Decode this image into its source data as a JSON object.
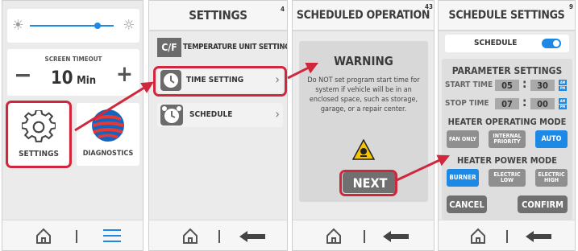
{
  "panel1": {
    "slider_value": 0.8,
    "screen_timeout": {
      "label": "SCREEN TIMEOUT",
      "minus": "−",
      "plus": "+",
      "value": "10",
      "unit": "Min"
    },
    "settings_label": "SETTINGS",
    "diagnostics_label": "DIAGNOSTICS"
  },
  "panel2": {
    "title": "SETTINGS",
    "page_number": "4",
    "items": [
      {
        "label": "TEMPERATURE UNIT SETTINGS",
        "icon": "temperature-unit-icon",
        "chevron": "›"
      },
      {
        "label": "TIME SETTING",
        "icon": "clock-icon",
        "chevron": "›"
      },
      {
        "label": "SCHEDULE",
        "icon": "alarm-clock-icon",
        "chevron": "›"
      }
    ]
  },
  "panel3": {
    "title": "SCHEDULED OPERATION",
    "page_number": "43",
    "warning_title": "WARNING",
    "warning_text": "Do NOT set program start time for system if vehicle will be in an enclosed space, such as storage, garage, or a repair center.",
    "next_label": "NEXT"
  },
  "panel4": {
    "title": "SCHEDULE SETTINGS",
    "page_number": "9",
    "schedule_label": "SCHEDULE",
    "schedule_on": true,
    "parameter_title": "PARAMETER SETTINGS",
    "start_time": {
      "label": "START TIME",
      "hour": "05",
      "minute": "30",
      "colon": ":",
      "am": "AM",
      "pm": "PM"
    },
    "stop_time": {
      "label": "STOP TIME",
      "hour": "07",
      "minute": "00",
      "colon": ":",
      "am": "AM",
      "pm": "PM"
    },
    "operating_mode_title": "HEATER OPERATING MODE",
    "operating_modes": {
      "fan_only": "FAN ONLY",
      "internal_priority": "INTERNAL PRIORITY",
      "auto": "AUTO"
    },
    "power_mode_title": "HEATER POWER MODE",
    "power_modes": {
      "burner": "BURNER",
      "electric_low": "ELECTRIC LOW",
      "electric_high": "ELECTRIC HIGH"
    },
    "cancel_label": "CANCEL",
    "confirm_label": "CONFIRM"
  },
  "colors": {
    "accent_red": "#d0273d",
    "accent_blue": "#1e88e5",
    "button_gray": "#8f8f8f",
    "panel_bg": "#ebebeb"
  }
}
